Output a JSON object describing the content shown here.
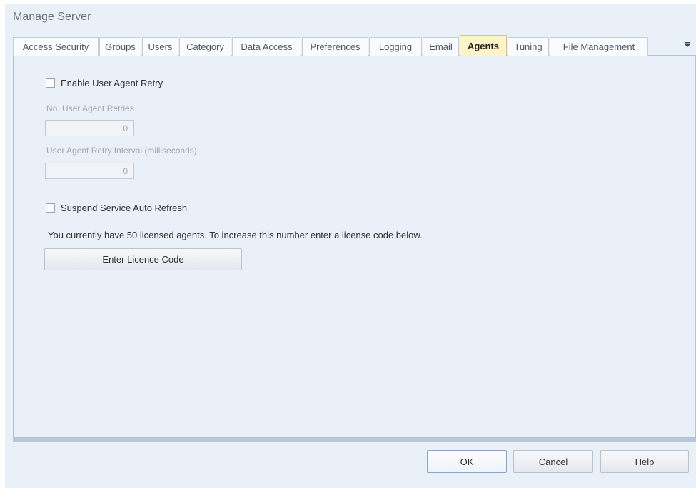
{
  "window": {
    "title": "Manage Server"
  },
  "tabs": [
    {
      "label": "Access Security",
      "active": false
    },
    {
      "label": "Groups",
      "active": false
    },
    {
      "label": "Users",
      "active": false
    },
    {
      "label": "Category",
      "active": false
    },
    {
      "label": "Data Access",
      "active": false
    },
    {
      "label": "Preferences",
      "active": false
    },
    {
      "label": "Logging",
      "active": false
    },
    {
      "label": "Email",
      "active": false
    },
    {
      "label": "Agents",
      "active": true
    },
    {
      "label": "Tuning",
      "active": false
    },
    {
      "label": "File Management",
      "active": false
    }
  ],
  "tab_overflow_icon": "chevron-down-overflow",
  "agents": {
    "enable_retry": {
      "label": "Enable User Agent Retry",
      "checked": false
    },
    "retries": {
      "label": "No. User Agent Retries",
      "value": "0",
      "enabled": false
    },
    "retry_interval": {
      "label": "User Agent Retry Interval (milliseconds)",
      "value": "0",
      "enabled": false
    },
    "suspend_refresh": {
      "label": "Suspend Service Auto Refresh",
      "checked": false
    },
    "license_info": "You currently have 50 licensed agents. To increase this number enter a license code below.",
    "enter_licence_label": "Enter Licence Code"
  },
  "footer": {
    "ok_label": "OK",
    "cancel_label": "Cancel",
    "help_label": "Help"
  },
  "colors": {
    "window_bg": "#eaf0f7",
    "active_tab_bg": "#fff3c8",
    "disabled_text": "#a0a8b2"
  }
}
